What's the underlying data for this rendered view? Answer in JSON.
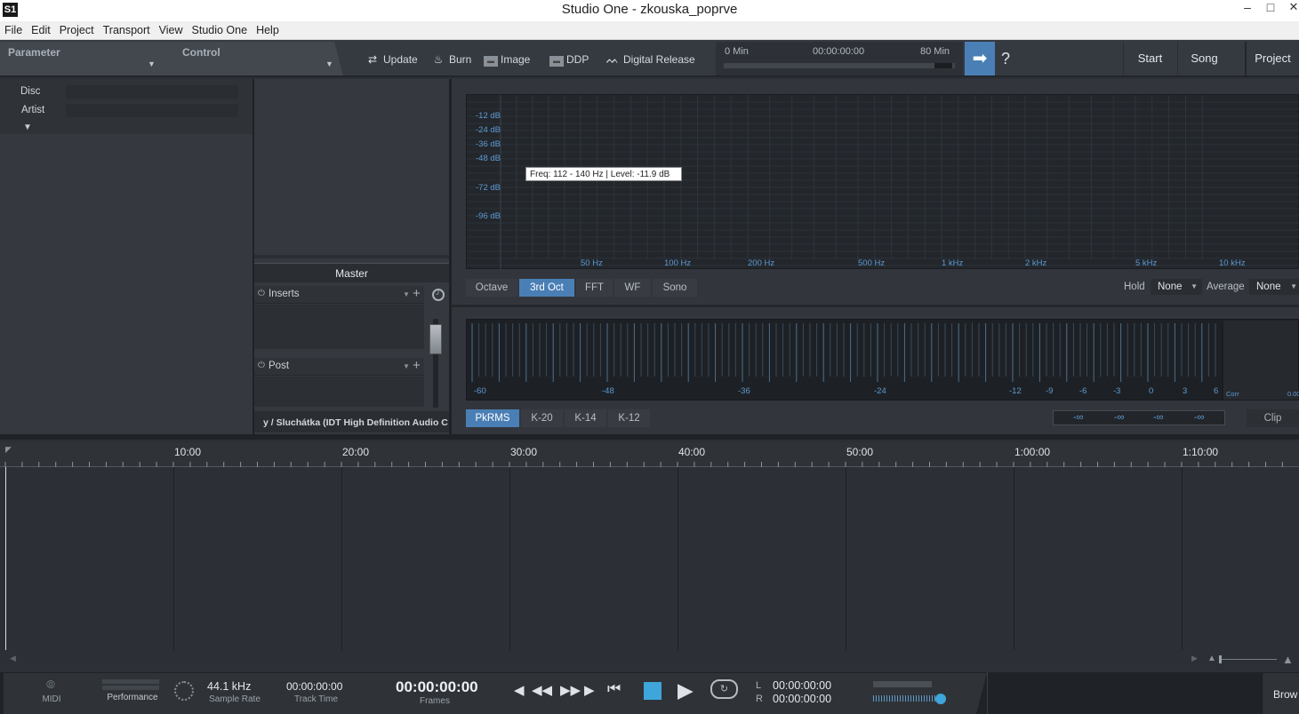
{
  "window": {
    "title": "Studio One - zkouska_poprve",
    "app_icon": "studio-one-logo"
  },
  "menu": [
    "File",
    "Edit",
    "Project",
    "Transport",
    "View",
    "Studio One",
    "Help"
  ],
  "toolbar": {
    "parameter_label": "Parameter",
    "control_label": "Control",
    "buttons": [
      {
        "label": "Update",
        "icon": "update-arrows-icon"
      },
      {
        "label": "Burn",
        "icon": "flame-icon"
      },
      {
        "label": "Image",
        "icon": "disk-image-icon"
      },
      {
        "label": "DDP",
        "icon": "ddp-icon"
      },
      {
        "label": "Digital Release",
        "icon": "waveform-icon"
      }
    ],
    "mini_timeline": {
      "start": "0 Min",
      "time": "00:00:00:00",
      "end": "80 Min"
    },
    "help_label": "?",
    "nav": [
      "Start",
      "Song",
      "Project"
    ]
  },
  "metadata": {
    "disc_label": "Disc",
    "artist_label": "Artist",
    "disc_value": "",
    "artist_value": ""
  },
  "mixer": {
    "channel_name": "Master",
    "inserts_label": "Inserts",
    "post_label": "Post",
    "output": "y / Sluchátka (IDT High Definition Audio C"
  },
  "spectrum": {
    "db_labels": [
      "-12 dB",
      "-24 dB",
      "-36 dB",
      "-48 dB",
      "-72 dB",
      "-96 dB"
    ],
    "hz_labels": [
      "50 Hz",
      "100 Hz",
      "200 Hz",
      "500 Hz",
      "1 kHz",
      "2 kHz",
      "5 kHz",
      "10 kHz"
    ],
    "tooltip": "Freq: 112 - 140 Hz | Level: -11.9 dB",
    "modes": [
      "Octave",
      "3rd Oct",
      "FFT",
      "WF",
      "Sono"
    ],
    "selected_mode": "3rd Oct",
    "hold_label": "Hold",
    "hold_value": "None",
    "average_label": "Average",
    "average_value": "None"
  },
  "level_meter": {
    "scale": [
      "-60",
      "-48",
      "-36",
      "-24",
      "-12",
      "-9",
      "-6",
      "-3",
      "0",
      "3",
      "6"
    ],
    "corr_label": "Corr",
    "corr_value": "0.00",
    "modes": [
      "PkRMS",
      "K-20",
      "K-14",
      "K-12"
    ],
    "selected_mode": "PkRMS",
    "peak_values": [
      "-∞",
      "-∞",
      "-∞",
      "-∞"
    ],
    "clip_label": "Clip"
  },
  "ruler": [
    "10:00",
    "20:00",
    "30:00",
    "40:00",
    "50:00",
    "1:00:00",
    "1:10:00"
  ],
  "transport": {
    "midi_label": "MIDI",
    "performance_label": "Performance",
    "sample_rate": "44.1 kHz",
    "sample_rate_label": "Sample Rate",
    "track_time": "00:00:00:00",
    "track_time_label": "Track Time",
    "position": "00:00:00:00",
    "frames_label": "Frames",
    "loop_l_label": "L",
    "loop_r_label": "R",
    "loop_l": "00:00:00:00",
    "loop_r": "00:00:00:00",
    "browse_label": "Brow"
  },
  "colors": {
    "accent": "#4a7fb5",
    "meter_text": "#5d9ad3",
    "background": "#2c3036"
  }
}
